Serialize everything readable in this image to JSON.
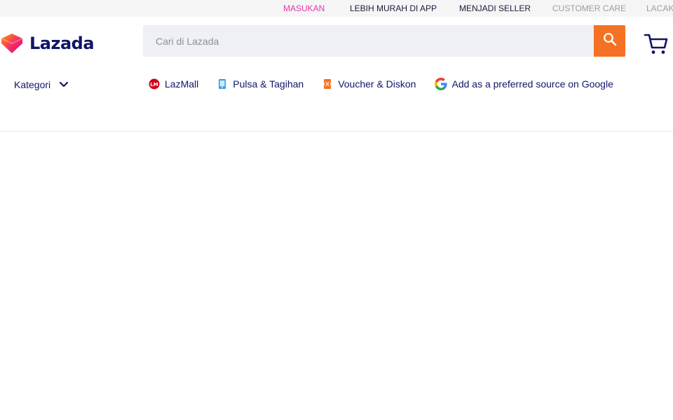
{
  "topbar": {
    "links": [
      {
        "label": "MASUKAN",
        "color": "#e535ab"
      },
      {
        "label": "LEBIH MURAH DI APP"
      },
      {
        "label": "MENJADI SELLER"
      },
      {
        "label": "CUSTOMER CARE",
        "color": "#9e9e9e"
      },
      {
        "label": "LACAK",
        "color": "#9e9e9e"
      }
    ]
  },
  "header": {
    "logo_text": "Lazada",
    "search": {
      "placeholder": "Cari di Lazada",
      "value": ""
    },
    "icons": [
      "search-icon",
      "cart-icon"
    ]
  },
  "nav": {
    "kategori_label": "Kategori",
    "links": [
      {
        "label": "LazMall",
        "icon": "lazmall-icon"
      },
      {
        "label": "Pulsa & Tagihan",
        "icon": "phone-bill-icon"
      },
      {
        "label": "Voucher & Diskon",
        "icon": "voucher-icon"
      },
      {
        "label": "Add as a preferred source on Google",
        "icon": "google-icon"
      }
    ]
  },
  "colors": {
    "brand_navy": "#101566",
    "accent_orange": "#f57224",
    "accent_pink": "#e535ab",
    "search_bg": "#eff0f5"
  }
}
